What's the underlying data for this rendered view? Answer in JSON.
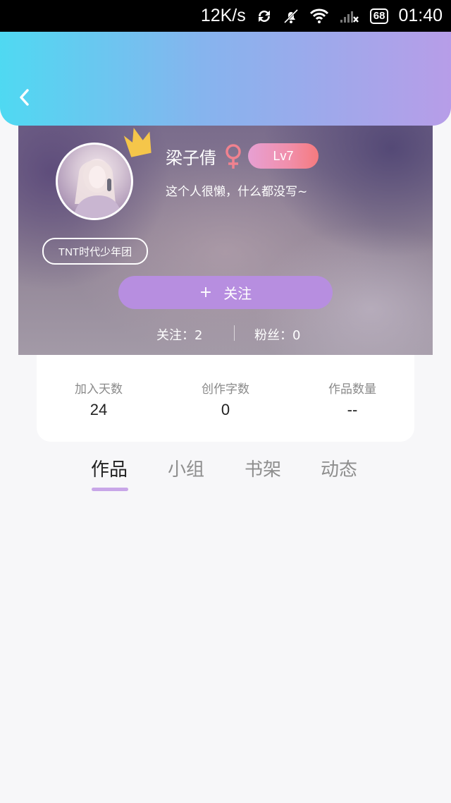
{
  "status_bar": {
    "speed": "12K/s",
    "battery": "68",
    "time": "01:40",
    "icons": [
      "sync-icon",
      "bell-off-icon",
      "wifi-icon",
      "signal-icon",
      "battery-icon"
    ]
  },
  "header": {
    "back_icon": "chevron-left-icon",
    "gradient_colors": [
      "#4fd9f2",
      "#86b4ee",
      "#b79de8"
    ]
  },
  "profile": {
    "name": "梁子倩",
    "gender_icon": "female-icon",
    "gender_color": "#f0828f",
    "level": "Lv7",
    "bio": "这个人很懒，什么都没写~",
    "group_tag": "TNT时代少年团",
    "crown_icon": "crown-icon",
    "follow_button": "关注",
    "follow_plus": "+",
    "following": "关注：2",
    "fans": "粉丝：0"
  },
  "stats": [
    {
      "label": "加入天数",
      "value": "24"
    },
    {
      "label": "创作字数",
      "value": "0"
    },
    {
      "label": "作品数量",
      "value": "--"
    }
  ],
  "tabs": [
    {
      "label": "作品",
      "active": true
    },
    {
      "label": "小组",
      "active": false
    },
    {
      "label": "书架",
      "active": false
    },
    {
      "label": "动态",
      "active": false
    }
  ],
  "colors": {
    "accent": "#b78ee0",
    "tab_indicator": "#c8a6e8",
    "crown": "#f5c64a"
  }
}
